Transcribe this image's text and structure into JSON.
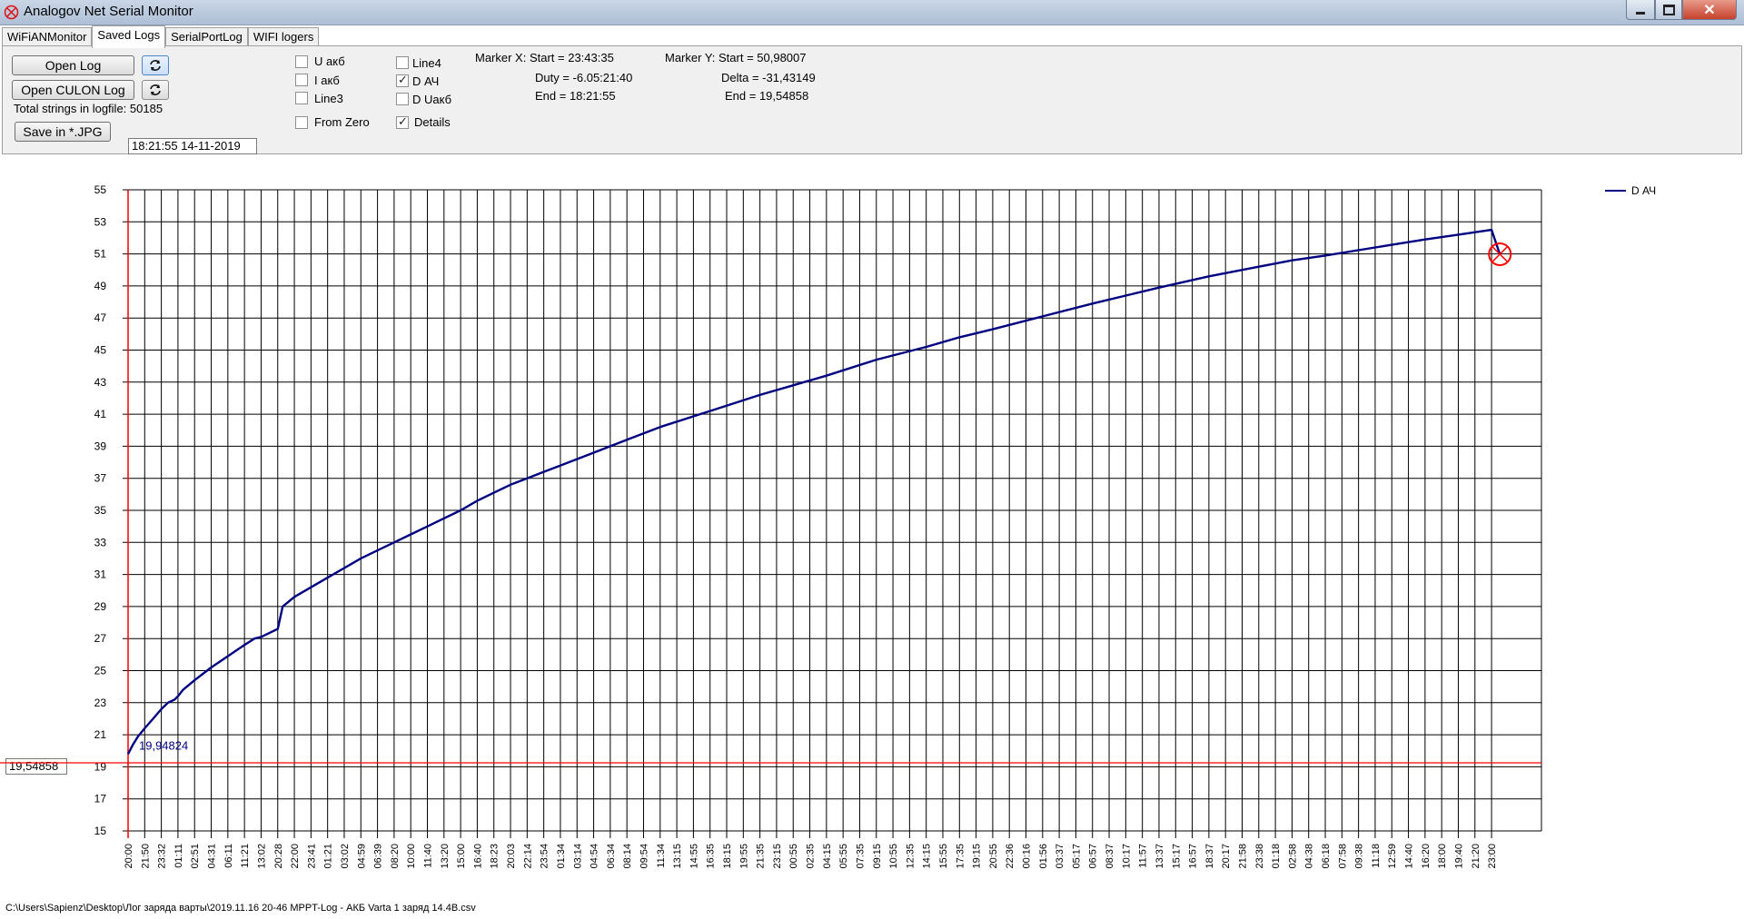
{
  "window": {
    "title": "Analogov Net Serial Monitor"
  },
  "tabs": [
    {
      "label": "WiFiANMonitor",
      "active": false
    },
    {
      "label": "Saved Logs",
      "active": true
    },
    {
      "label": "SerialPortLog",
      "active": false
    },
    {
      "label": "WIFI logers",
      "active": false
    }
  ],
  "toolbar": {
    "open_log": "Open Log",
    "open_culon_log": "Open CULON Log",
    "save_jpg": "Save in *.JPG",
    "total_strings": "Total strings in logfile: 50185",
    "datetime": "18:21:55 14-11-2019"
  },
  "checkboxes": [
    {
      "label": "U акб",
      "checked": false
    },
    {
      "label": "I акб",
      "checked": false
    },
    {
      "label": "Line3",
      "checked": false
    },
    {
      "label": "From Zero",
      "checked": false
    },
    {
      "label": "Line4",
      "checked": false
    },
    {
      "label": "D АЧ",
      "checked": true
    },
    {
      "label": "D Uакб",
      "checked": false
    },
    {
      "label": "Details",
      "checked": true
    }
  ],
  "marker_x": {
    "start": "Marker X: Start = 23:43:35",
    "duty": "Duty = -6.05:21:40",
    "end": "End  = 18:21:55"
  },
  "marker_y": {
    "start": "Marker Y: Start = 50,98007",
    "delta": "Delta = -31,43149",
    "end": "End  = 19,54858"
  },
  "y_marker_value": "19,54858",
  "statusbar": {
    "path": "C:\\Users\\Sapienz\\Desktop\\Лог заряда варты\\2019.11.16 20-46 MPPT-Log -  АКБ Varta 1 заряд 14.4B.csv"
  },
  "colors": {
    "series": "#000080",
    "marker": "#ff0000",
    "grid": "#000000"
  },
  "chart_data": {
    "type": "line",
    "ylim": [
      15,
      55
    ],
    "yticks": [
      15,
      17,
      19,
      21,
      23,
      25,
      27,
      29,
      31,
      33,
      35,
      37,
      39,
      41,
      43,
      45,
      47,
      49,
      51,
      53,
      55
    ],
    "x_labels": [
      "20:00",
      "21:50",
      "23:32",
      "01:11",
      "02:51",
      "04:31",
      "06:11",
      "11:21",
      "13:02",
      "20:28",
      "22:00",
      "23:41",
      "01:21",
      "03:02",
      "04:59",
      "06:39",
      "08:20",
      "10:00",
      "11:40",
      "13:20",
      "15:00",
      "16:40",
      "18:23",
      "20:03",
      "22:14",
      "23:54",
      "01:34",
      "03:14",
      "04:54",
      "06:34",
      "08:14",
      "09:54",
      "11:34",
      "13:15",
      "14:55",
      "16:35",
      "18:15",
      "19:55",
      "21:35",
      "23:15",
      "00:55",
      "02:35",
      "04:15",
      "05:55",
      "07:35",
      "09:15",
      "10:55",
      "12:35",
      "14:15",
      "15:55",
      "17:35",
      "19:15",
      "20:55",
      "22:36",
      "00:16",
      "01:56",
      "03:37",
      "05:17",
      "06:57",
      "08:37",
      "10:17",
      "11:57",
      "13:37",
      "15:17",
      "16:57",
      "18:37",
      "20:17",
      "21:58",
      "23:38",
      "01:18",
      "02:58",
      "04:38",
      "06:18",
      "07:58",
      "09:38",
      "11:18",
      "12:59",
      "14:40",
      "16:20",
      "18:00",
      "19:40",
      "21:20",
      "23:00"
    ],
    "legend": [
      {
        "name": "D АЧ"
      }
    ],
    "legend_position": "top-right",
    "series": [
      {
        "name": "D АЧ",
        "x_index": [
          0,
          0.3,
          0.6,
          1,
          1.5,
          2,
          2.4,
          2.8,
          3,
          3.3,
          4,
          5,
          6,
          7,
          7.6,
          7.6,
          8,
          8,
          9,
          9,
          9.3,
          9.3,
          10,
          11,
          12,
          13,
          14,
          15,
          16,
          17,
          18,
          19,
          20,
          21,
          22,
          23,
          24,
          25,
          26,
          28,
          30,
          32,
          35,
          38,
          40,
          42,
          45,
          48,
          50,
          52,
          55,
          58,
          60,
          62,
          65,
          68,
          70,
          72,
          75,
          78,
          80,
          82,
          82.5
        ],
        "values": [
          19.8,
          20.4,
          20.9,
          21.4,
          22.0,
          22.6,
          23.0,
          23.2,
          23.4,
          23.8,
          24.4,
          25.2,
          25.9,
          26.6,
          27.0,
          27.0,
          27.1,
          27.1,
          27.6,
          27.6,
          29.0,
          29.0,
          29.6,
          30.2,
          30.8,
          31.4,
          32.0,
          32.5,
          33.0,
          33.5,
          34.0,
          34.5,
          35.0,
          35.6,
          36.1,
          36.6,
          37.0,
          37.4,
          37.8,
          38.6,
          39.4,
          40.2,
          41.2,
          42.2,
          42.8,
          43.4,
          44.4,
          45.2,
          45.8,
          46.3,
          47.1,
          47.9,
          48.4,
          48.9,
          49.6,
          50.2,
          50.6,
          50.9,
          51.4,
          51.9,
          52.2,
          52.5,
          50.98
        ]
      }
    ],
    "annotation": "19,94824",
    "marker_x_index": [
      0,
      82.5
    ],
    "marker_y_value": 19.25
  }
}
